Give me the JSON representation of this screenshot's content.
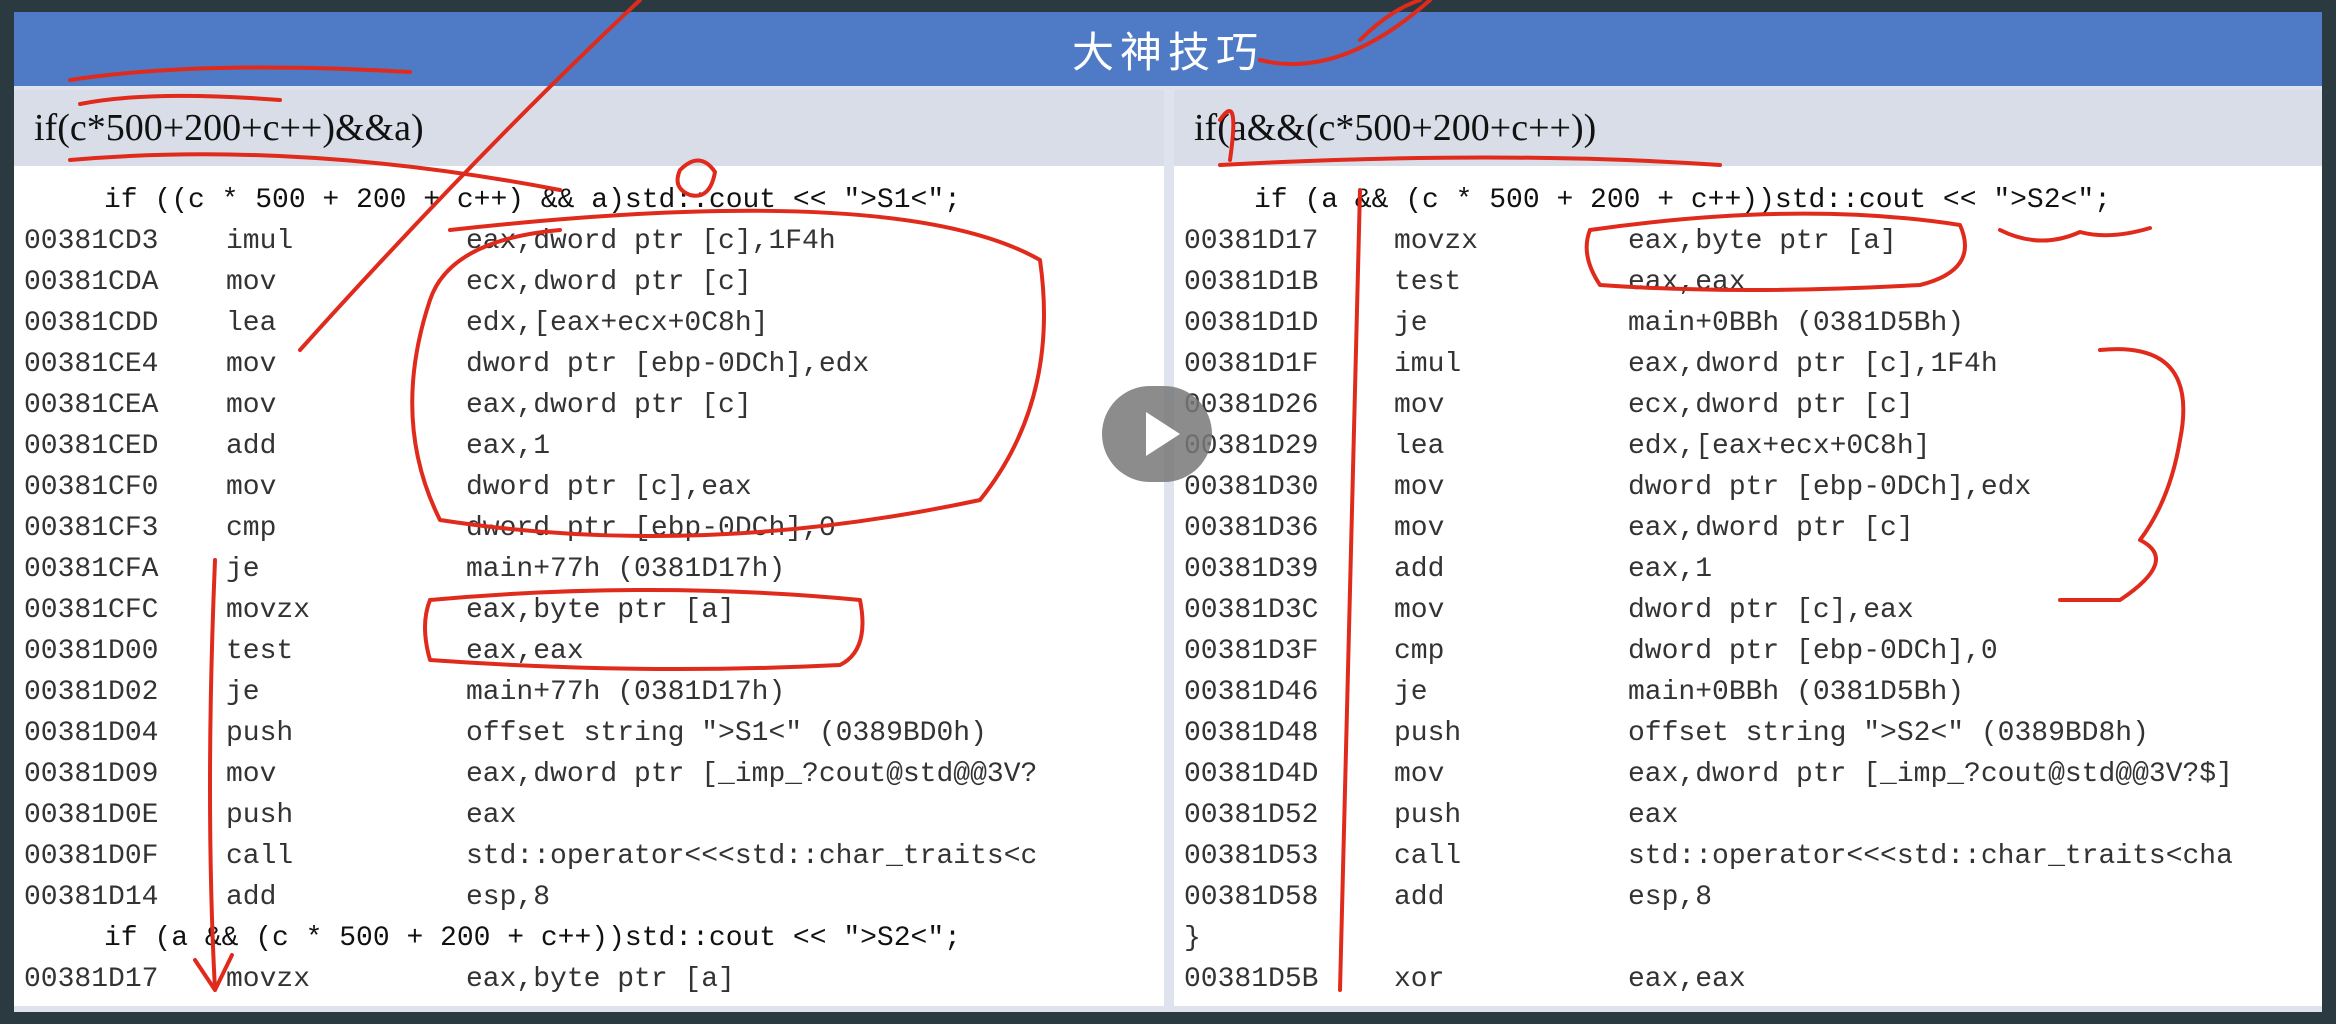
{
  "title": "大神技巧",
  "colors": {
    "title_bar": "#4f7bc6",
    "ink": "#e02a1c"
  },
  "left": {
    "header": "if(c*500+200+c++)&&a)",
    "lines": [
      {
        "src": "if ((c * 500 + 200 + c++) && a)std::cout << \">S1<\";"
      },
      {
        "addr": "00381CD3",
        "mn": "imul",
        "op": "eax,dword ptr [c],1F4h"
      },
      {
        "addr": "00381CDA",
        "mn": "mov",
        "op": "ecx,dword ptr [c]"
      },
      {
        "addr": "00381CDD",
        "mn": "lea",
        "op": "edx,[eax+ecx+0C8h]"
      },
      {
        "addr": "00381CE4",
        "mn": "mov",
        "op": "dword ptr [ebp-0DCh],edx"
      },
      {
        "addr": "00381CEA",
        "mn": "mov",
        "op": "eax,dword ptr [c]"
      },
      {
        "addr": "00381CED",
        "mn": "add",
        "op": "eax,1"
      },
      {
        "addr": "00381CF0",
        "mn": "mov",
        "op": "dword ptr [c],eax"
      },
      {
        "addr": "00381CF3",
        "mn": "cmp",
        "op": "dword ptr [ebp-0DCh],0"
      },
      {
        "addr": "00381CFA",
        "mn": "je",
        "op": "main+77h (0381D17h)"
      },
      {
        "addr": "00381CFC",
        "mn": "movzx",
        "op": "eax,byte ptr [a]"
      },
      {
        "addr": "00381D00",
        "mn": "test",
        "op": "eax,eax"
      },
      {
        "addr": "00381D02",
        "mn": "je",
        "op": "main+77h (0381D17h)"
      },
      {
        "addr": "00381D04",
        "mn": "push",
        "op": "offset string \">S1<\" (0389BD0h)"
      },
      {
        "addr": "00381D09",
        "mn": "mov",
        "op": "eax,dword ptr [_imp_?cout@std@@3V?"
      },
      {
        "addr": "00381D0E",
        "mn": "push",
        "op": "eax"
      },
      {
        "addr": "00381D0F",
        "mn": "call",
        "op": "std::operator<<<std::char_traits<c"
      },
      {
        "addr": "00381D14",
        "mn": "add",
        "op": "esp,8"
      },
      {
        "src": "if (a && (c * 500 + 200 + c++))std::cout << \">S2<\";"
      },
      {
        "addr": "00381D17",
        "mn": "movzx",
        "op": "eax,byte ptr [a]"
      }
    ]
  },
  "right": {
    "header": "if(a&&(c*500+200+c++))",
    "lines": [
      {
        "src": "if (a && (c * 500 + 200 + c++))std::cout << \">S2<\";"
      },
      {
        "addr": "00381D17",
        "mn": "movzx",
        "op": "eax,byte ptr [a]"
      },
      {
        "addr": "00381D1B",
        "mn": "test",
        "op": "eax,eax"
      },
      {
        "addr": "00381D1D",
        "mn": "je",
        "op": "main+0BBh (0381D5Bh)"
      },
      {
        "addr": "00381D1F",
        "mn": "imul",
        "op": "eax,dword ptr [c],1F4h"
      },
      {
        "addr": "00381D26",
        "mn": "mov",
        "op": "ecx,dword ptr [c]"
      },
      {
        "addr": "00381D29",
        "mn": "lea",
        "op": "edx,[eax+ecx+0C8h]"
      },
      {
        "addr": "00381D30",
        "mn": "mov",
        "op": "dword ptr [ebp-0DCh],edx"
      },
      {
        "addr": "00381D36",
        "mn": "mov",
        "op": "eax,dword ptr [c]"
      },
      {
        "addr": "00381D39",
        "mn": "add",
        "op": "eax,1"
      },
      {
        "addr": "00381D3C",
        "mn": "mov",
        "op": "dword ptr [c],eax"
      },
      {
        "addr": "00381D3F",
        "mn": "cmp",
        "op": "dword ptr [ebp-0DCh],0"
      },
      {
        "addr": "00381D46",
        "mn": "je",
        "op": "main+0BBh (0381D5Bh)"
      },
      {
        "addr": "00381D48",
        "mn": "push",
        "op": "offset string \">S2<\" (0389BD8h)"
      },
      {
        "addr": "00381D4D",
        "mn": "mov",
        "op": "eax,dword ptr [_imp_?cout@std@@3V?$]"
      },
      {
        "addr": "00381D52",
        "mn": "push",
        "op": "eax"
      },
      {
        "addr": "00381D53",
        "mn": "call",
        "op": "std::operator<<<std::char_traits<cha"
      },
      {
        "addr": "00381D58",
        "mn": "add",
        "op": "esp,8"
      },
      {
        "brace": "}"
      },
      {
        "addr": "00381D5B",
        "mn": "xor",
        "op": "eax,eax"
      }
    ]
  },
  "video": {
    "play_icon": "play-icon"
  }
}
